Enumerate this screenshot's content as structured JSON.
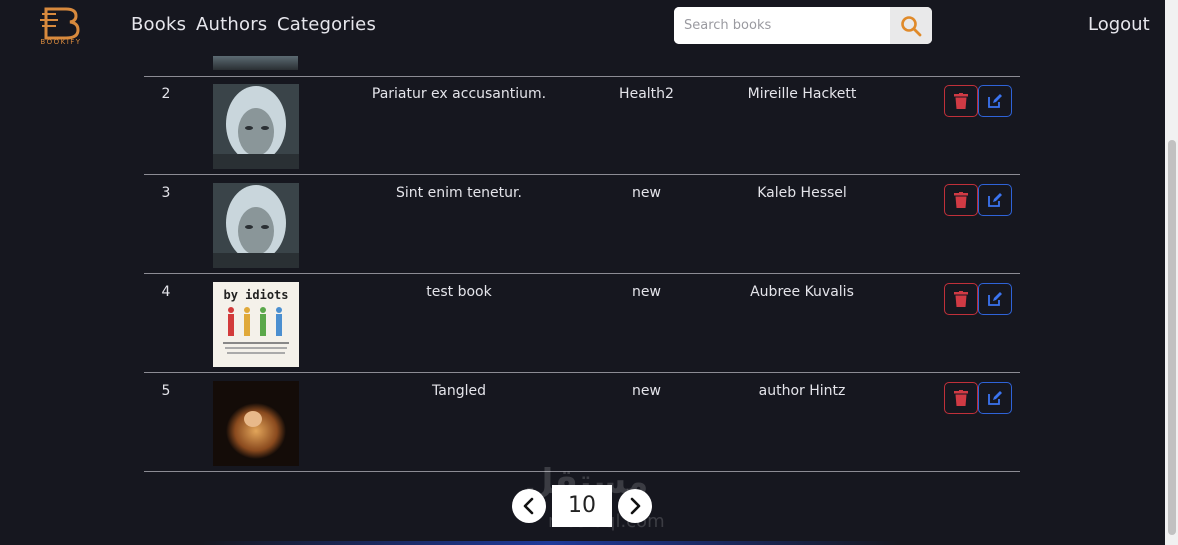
{
  "brand": {
    "name": "BOOKIFY",
    "accent": "#d88a3d"
  },
  "nav": {
    "books": "Books",
    "authors": "Authors",
    "categories": "Categories",
    "logout": "Logout"
  },
  "search": {
    "placeholder": "Search books",
    "value": "",
    "icon": "search-icon"
  },
  "table": {
    "rows": [
      {
        "num": "2",
        "title": "Pariatur ex accusantium.",
        "category": "Health2",
        "author": "Mireille Hackett",
        "cover": "woman-portrait"
      },
      {
        "num": "3",
        "title": "Sint enim tenetur.",
        "category": "new",
        "author": "Kaleb Hessel",
        "cover": "woman-portrait"
      },
      {
        "num": "4",
        "title": "test book",
        "category": "new",
        "author": "Aubree Kuvalis",
        "cover": "by-idiots-cover",
        "cover_title": "by idiots"
      },
      {
        "num": "5",
        "title": "Tangled",
        "category": "new",
        "author": "author Hintz",
        "cover": "tangled-cover"
      }
    ],
    "actions": {
      "delete_icon": "trash-icon",
      "edit_icon": "edit-icon",
      "delete_color": "#c0303a",
      "edit_color": "#2f63d8"
    }
  },
  "pagination": {
    "current": "10",
    "prev_icon": "chevron-left-icon",
    "next_icon": "chevron-right-icon"
  },
  "watermark": {
    "arabic": "مستقل",
    "latin": "mostaql.com"
  }
}
